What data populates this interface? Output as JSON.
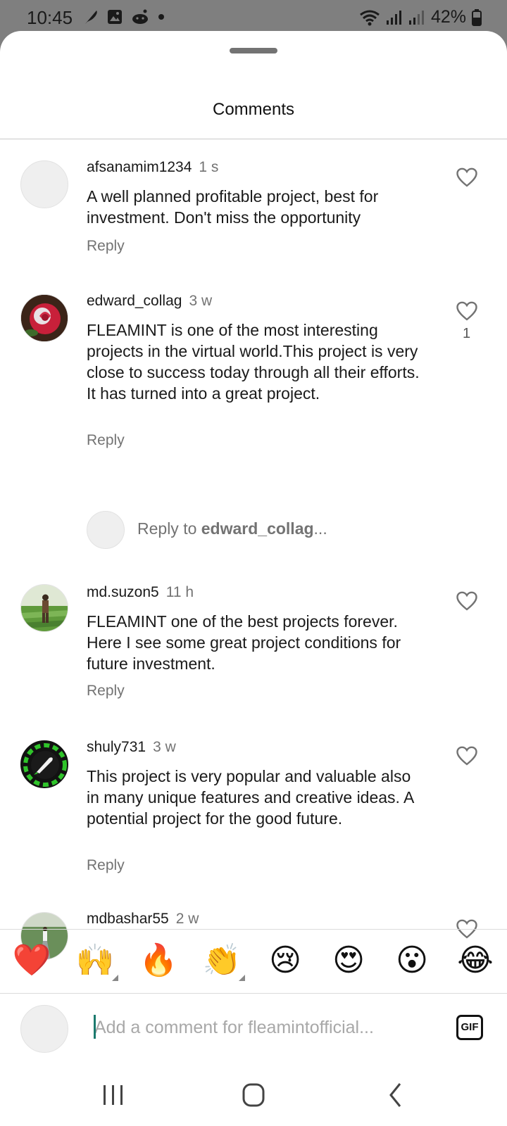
{
  "status_bar": {
    "time": "10:45",
    "battery": "42%",
    "icons": [
      "feather-icon",
      "image-icon",
      "reddit-icon",
      "dot-icon",
      "wifi-icon",
      "signal-icon",
      "signal-icon",
      "battery-icon"
    ]
  },
  "sheet": {
    "title": "Comments"
  },
  "comments": [
    {
      "username": "afsanamim1234",
      "time": "1 s",
      "text": "A well planned profitable project, best for investment. Don't miss the opportunity",
      "reply_label": "Reply",
      "likes": ""
    },
    {
      "username": "edward_collag",
      "time": "3 w",
      "text": "FLEAMINT is one of the most interesting projects in the virtual world.This project is very close to success today through all their efforts. It has turned into a great project.",
      "reply_label": "Reply",
      "likes": "1"
    },
    {
      "username": "md.suzon5",
      "time": "11 h",
      "text": "FLEAMINT one of the best projects forever. Here I see some great project conditions for future investment.",
      "reply_label": "Reply",
      "likes": ""
    },
    {
      "username": "shuly731",
      "time": "3 w",
      "text": "This project is very popular and valuable also in many unique features and creative ideas. A potential project for the good future.",
      "reply_label": "Reply",
      "likes": ""
    },
    {
      "username": "mdbashar55",
      "time": "2 w",
      "text": "",
      "reply_label": "",
      "likes": ""
    }
  ],
  "reply_to": {
    "prefix": "Reply to ",
    "username": "edward_collag",
    "suffix": "..."
  },
  "emoji_bar": [
    "❤️",
    "🙌",
    "🔥",
    "👏",
    "😢",
    "😍",
    "😮",
    "😂"
  ],
  "composer": {
    "placeholder": "Add a comment for fleamintofficial...",
    "gif_label": "GIF"
  },
  "colors": {
    "status_bar_bg": "#7f7f7f",
    "secondary_text": "#737373",
    "cursor": "#1b7a6e"
  }
}
